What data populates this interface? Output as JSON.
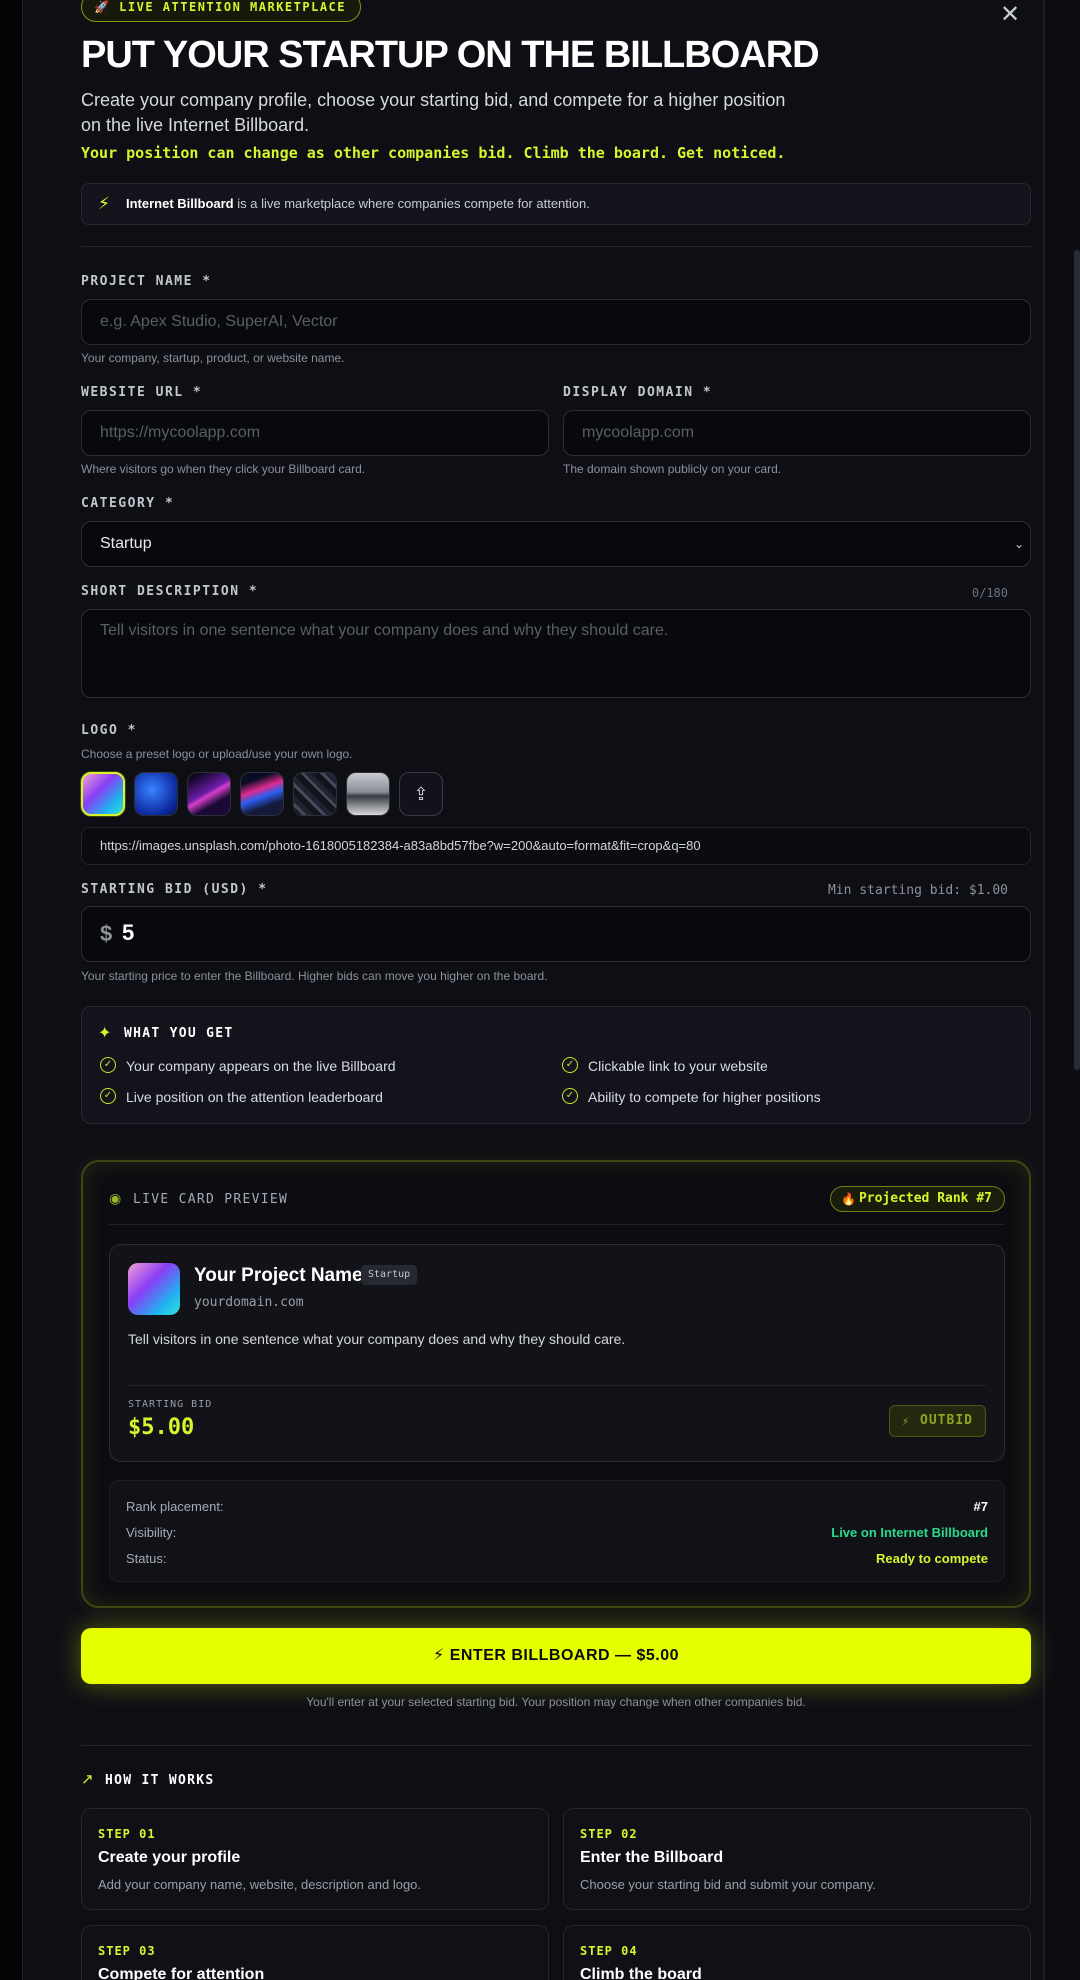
{
  "header": {
    "badge": "🚀 LIVE ATTENTION MARKETPLACE",
    "title": "PUT YOUR STARTUP ON THE BILLBOARD",
    "subtitle": "Create your company profile, choose your starting bid, and compete for a higher position on the live Internet Billboard.",
    "tagline": "Your position can change as other companies bid. Climb the board. Get noticed.",
    "close_icon": "close-icon"
  },
  "info": {
    "bold": "Internet Billboard",
    "rest": " is a live marketplace where companies compete for attention."
  },
  "form": {
    "project_name": {
      "label": "PROJECT NAME *",
      "placeholder": "e.g. Apex Studio, SuperAI, Vector",
      "value": "",
      "help": "Your company, startup, product, or website name."
    },
    "website_url": {
      "label": "WEBSITE URL *",
      "placeholder": "https://mycoolapp.com",
      "value": "",
      "help": "Where visitors go when they click your Billboard card."
    },
    "display_domain": {
      "label": "DISPLAY DOMAIN *",
      "placeholder": "mycoolapp.com",
      "value": "",
      "help": "The domain shown publicly on your card."
    },
    "category": {
      "label": "CATEGORY *",
      "value": "Startup"
    },
    "short_description": {
      "label": "SHORT DESCRIPTION *",
      "placeholder": "Tell visitors in one sentence what your company does and why they should care.",
      "counter": "0/180"
    },
    "logo": {
      "label": "LOGO *",
      "help": "Choose a preset logo or upload/use your own logo.",
      "url": "https://images.unsplash.com/photo-1618005182384-a83a8bd57fbe?w=200&auto=format&fit=crop&q=80"
    },
    "starting_bid": {
      "label": "STARTING BID (USD) *",
      "min": "Min starting bid: $1.00",
      "currency": "$",
      "value": "5",
      "help": "Your starting price to enter the Billboard. Higher bids can move you higher on the board."
    }
  },
  "what_you_get": {
    "title": "WHAT YOU GET",
    "items": [
      "Your company appears on the live Billboard",
      "Clickable link to your website",
      "Live position on the attention leaderboard",
      "Ability to compete for higher positions"
    ]
  },
  "preview": {
    "label": "LIVE CARD PREVIEW",
    "rank_badge": "Projected Rank #7",
    "card": {
      "name": "Your Project Name",
      "category": "Startup",
      "domain": "yourdomain.com",
      "description": "Tell visitors in one sentence what your company does and why they should care.",
      "bid_label": "STARTING BID",
      "bid": "$5.00",
      "outbid": "OUTBID"
    },
    "stats": [
      {
        "key": "Rank placement:",
        "value": "#7",
        "color": "#ffffff"
      },
      {
        "key": "Visibility:",
        "value": "Live on Internet Billboard",
        "color": "#2bd98a"
      },
      {
        "key": "Status:",
        "value": "Ready to compete",
        "color": "#d8f52c"
      }
    ]
  },
  "cta": {
    "label": "ENTER BILLBOARD — $5.00",
    "note": "You'll enter at your selected starting bid. Your position may change when other companies bid."
  },
  "how_it_works": {
    "title": "HOW IT WORKS",
    "steps": [
      {
        "num": "STEP 01",
        "title": "Create your profile",
        "desc": "Add your company name, website, description and logo."
      },
      {
        "num": "STEP 02",
        "title": "Enter the Billboard",
        "desc": "Choose your starting bid and submit your company."
      },
      {
        "num": "STEP 03",
        "title": "Compete for attention",
        "desc": ""
      },
      {
        "num": "STEP 04",
        "title": "Climb the board",
        "desc": ""
      }
    ]
  },
  "colors": {
    "accent": "#e6ff00",
    "accent_text": "#d8f52c",
    "live": "#2bd98a",
    "panel": "#0e0f15"
  }
}
